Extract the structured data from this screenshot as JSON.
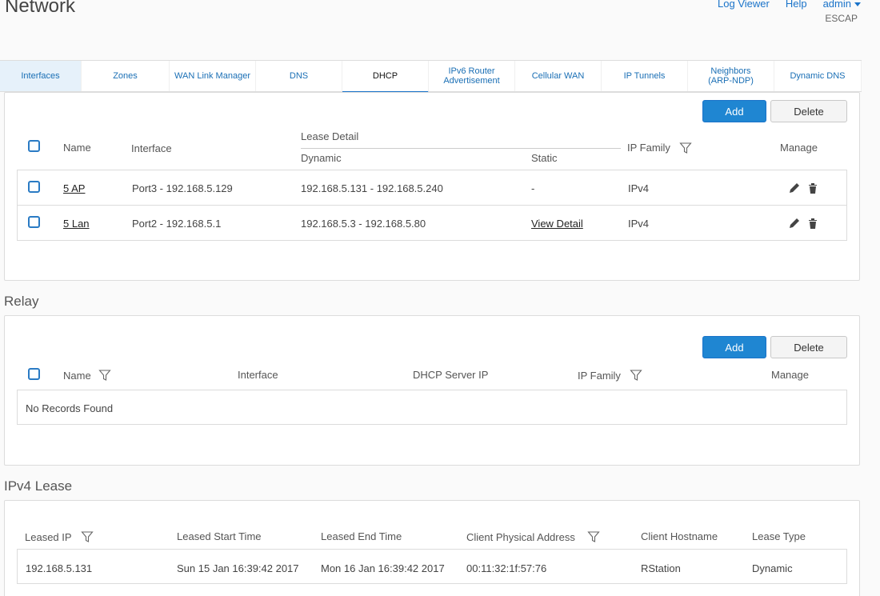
{
  "header": {
    "title": "Network",
    "links": {
      "log_viewer": "Log Viewer",
      "help": "Help",
      "user": "admin"
    },
    "device": "ESCAP"
  },
  "tabs": [
    {
      "label": "Interfaces"
    },
    {
      "label": "Zones"
    },
    {
      "label": "WAN Link Manager"
    },
    {
      "label": "DNS"
    },
    {
      "label": "DHCP"
    },
    {
      "label": "IPv6 Router Advertisement"
    },
    {
      "label": "Cellular WAN"
    },
    {
      "label": "IP Tunnels"
    },
    {
      "label": "Neighbors (ARP-NDP)"
    },
    {
      "label": "Dynamic DNS"
    }
  ],
  "server": {
    "add_label": "Add",
    "delete_label": "Delete",
    "headers": {
      "name": "Name",
      "interface": "Interface",
      "lease_detail": "Lease Detail",
      "dynamic": "Dynamic",
      "static": "Static",
      "ip_family": "IP Family",
      "manage": "Manage"
    },
    "rows": [
      {
        "name": "5 AP",
        "interface": "Port3 - 192.168.5.129",
        "dynamic": "192.168.5.131 - 192.168.5.240",
        "static": "-",
        "ip_family": "IPv4"
      },
      {
        "name": "5 Lan",
        "interface": "Port2 - 192.168.5.1",
        "dynamic": "192.168.5.3 - 192.168.5.80",
        "static": "View Detail",
        "ip_family": "IPv4"
      }
    ]
  },
  "relay": {
    "title": "Relay",
    "add_label": "Add",
    "delete_label": "Delete",
    "headers": {
      "name": "Name",
      "interface": "Interface",
      "dhcp_server_ip": "DHCP Server IP",
      "ip_family": "IP Family",
      "manage": "Manage"
    },
    "empty": "No Records Found"
  },
  "lease": {
    "title": "IPv4 Lease",
    "headers": {
      "leased_ip": "Leased IP",
      "start": "Leased Start Time",
      "end": "Leased End Time",
      "mac": "Client Physical Address",
      "hostname": "Client Hostname",
      "type": "Lease Type"
    },
    "rows": [
      {
        "leased_ip": "192.168.5.131",
        "start": "Sun 15 Jan 16:39:42 2017",
        "end": "Mon 16 Jan 16:39:42 2017",
        "mac": "00:11:32:1f:57:76",
        "hostname": "RStation",
        "type": "Dynamic"
      }
    ]
  },
  "colors": {
    "accent": "#1f86d2",
    "link": "#1a6fb5",
    "active_tab_bg": "#e6f1fa"
  }
}
